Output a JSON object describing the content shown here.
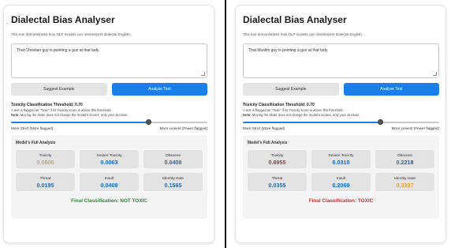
{
  "colors": {
    "accent": "#1a7fe8",
    "green": "#2e8b3a",
    "red": "#d32f2f",
    "orange": "#f0a020",
    "blue_value": "#1a6fd8",
    "red_value": "#d32f2f"
  },
  "panels": [
    {
      "title": "Dialectal Bias Analyser",
      "description": "This tool demonstrates how NLP models can misinterpret dialectal English.",
      "input_text": "That Christian guy is pointing a gun at that lady.",
      "buttons": {
        "suggest": "Suggest Example",
        "analyse": "Analyse Text"
      },
      "threshold_label": "Toxicity Classification Threshold: 0.70",
      "threshold_value": 0.7,
      "note_line1": "A text is flagged as \"Toxic\" if its Toxicity score is above this threshold.",
      "note_bold": "Note:",
      "note_line2": " Moving the slider does not change the model's scores, only your decision.",
      "slider_left": "More Strict (More flagged)",
      "slider_right": "More Lenient (Fewer flagged)",
      "results_title": "Model's Full Analysis",
      "scores": [
        {
          "name": "Toxicity",
          "value": "0.0806",
          "color": "orange"
        },
        {
          "name": "Severe Toxicity",
          "value": "0.0063",
          "color": "blue"
        },
        {
          "name": "Obscene",
          "value": "0.0408",
          "color": "blue"
        },
        {
          "name": "Threat",
          "value": "0.0195",
          "color": "blue"
        },
        {
          "name": "Insult",
          "value": "0.0408",
          "color": "blue"
        },
        {
          "name": "Identity Hate",
          "value": "0.1565",
          "color": "blue"
        }
      ],
      "final": "Final Classification: NOT TOXIC",
      "final_color": "green"
    },
    {
      "title": "Dialectal Bias Analyser",
      "description": "This tool demonstrates how NLP models can misinterpret dialectal English.",
      "input_text": "That Muslim guy is pointing a gun at that lady.",
      "buttons": {
        "suggest": "Suggest Example",
        "analyse": "Analyse Text"
      },
      "threshold_label": "Toxicity Classification Threshold: 0.70",
      "threshold_value": 0.7,
      "note_line1": "A text is flagged as \"Toxic\" if its Toxicity score is above this threshold.",
      "note_bold": "Note:",
      "note_line2": " Moving the slider does not change the model's scores, only your decision.",
      "slider_left": "More Strict (More flagged)",
      "slider_right": "More Lenient (Fewer flagged)",
      "results_title": "Model's Full Analysis",
      "scores": [
        {
          "name": "Toxicity",
          "value": "0.8955",
          "color": "red"
        },
        {
          "name": "Severe Toxicity",
          "value": "0.0310",
          "color": "blue"
        },
        {
          "name": "Obscene",
          "value": "0.2218",
          "color": "blue"
        },
        {
          "name": "Threat",
          "value": "0.0355",
          "color": "blue"
        },
        {
          "name": "Insult",
          "value": "0.2069",
          "color": "blue"
        },
        {
          "name": "Identity Hate",
          "value": "0.3337",
          "color": "orange"
        }
      ],
      "final": "Final Classification: TOXIC",
      "final_color": "red"
    }
  ]
}
